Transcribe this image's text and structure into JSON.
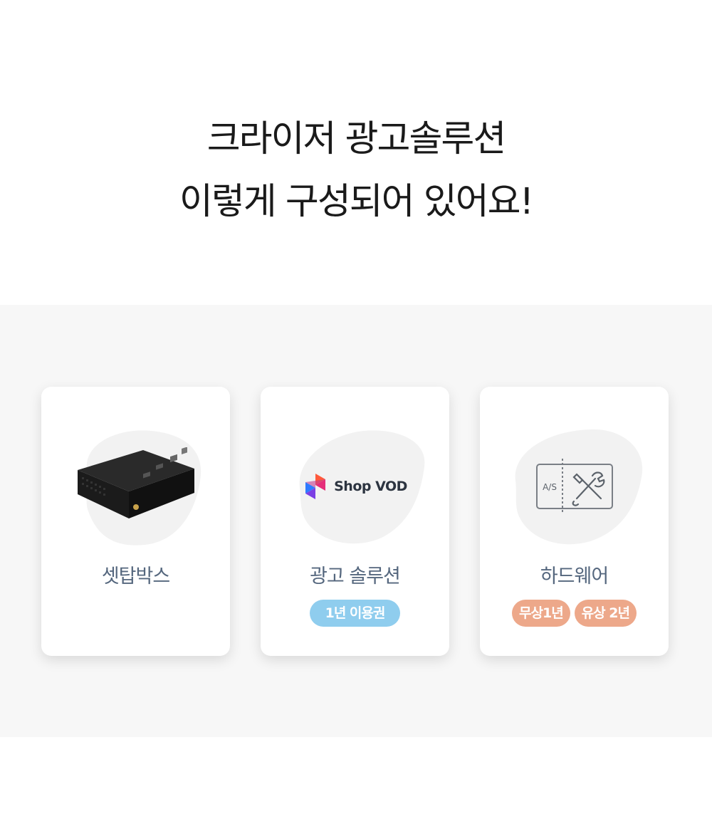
{
  "headline": {
    "line1": "크라이저 광고솔루션",
    "line2": "이렇게 구성되어 있어요!"
  },
  "cards": [
    {
      "label": "셋탑박스",
      "icon": "settop-box-icon"
    },
    {
      "label": "광고 솔루션",
      "logo_text": "Shop VOD",
      "icon": "shopvod-logo-icon",
      "badges": [
        "1년 이용권"
      ]
    },
    {
      "label": "하드웨어",
      "as_text": "A/S",
      "icon": "as-tools-icon",
      "badges": [
        "무상1년",
        "유상 2년"
      ]
    }
  ],
  "colors": {
    "band_bg": "#f7f7f7",
    "label": "#55677e",
    "badge_blue": "#8fcdee",
    "badge_orange": "#eda88a"
  }
}
